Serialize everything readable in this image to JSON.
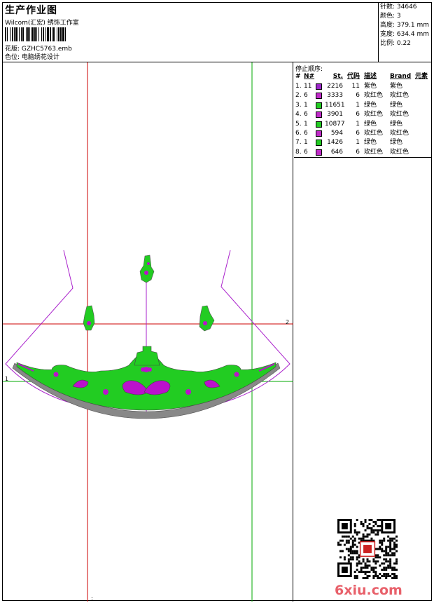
{
  "header": {
    "title": "生产作业图",
    "subtitle": "Wilcom(汇宏) 绣饰工作室",
    "file_label": "花版: GZHC5763.emb",
    "color_label": "色位: 电脑绣花设计"
  },
  "stats": {
    "stitches": "针数: 34646",
    "colors": "颜色: 3",
    "height": "高度: 379.1 mm",
    "width": "宽度: 634.4 mm",
    "scale": "比例: 0.22"
  },
  "stop_sequence": {
    "title": "停止顺序:",
    "headers": {
      "index": "#",
      "needle": "N#",
      "stitches": "St.",
      "code": "代码",
      "description": "描述",
      "brand": "Brand",
      "element": "元素"
    },
    "rows": [
      {
        "no": "1.",
        "needle": "11",
        "color": "#9c27c9",
        "stitches": "2216",
        "code": "11",
        "description": "紫色",
        "brand": "紫色"
      },
      {
        "no": "2.",
        "needle": "6",
        "color": "#c02ac8",
        "stitches": "3333",
        "code": "6",
        "description": "玫红色",
        "brand": "玫红色"
      },
      {
        "no": "3.",
        "needle": "1",
        "color": "#22cc22",
        "stitches": "11651",
        "code": "1",
        "description": "绿色",
        "brand": "绿色"
      },
      {
        "no": "4.",
        "needle": "6",
        "color": "#c02ac8",
        "stitches": "3901",
        "code": "6",
        "description": "玫红色",
        "brand": "玫红色"
      },
      {
        "no": "5.",
        "needle": "1",
        "color": "#22cc22",
        "stitches": "10877",
        "code": "1",
        "description": "绿色",
        "brand": "绿色"
      },
      {
        "no": "6.",
        "needle": "6",
        "color": "#c02ac8",
        "stitches": "594",
        "code": "6",
        "description": "玫红色",
        "brand": "玫红色"
      },
      {
        "no": "7.",
        "needle": "1",
        "color": "#22cc22",
        "stitches": "1426",
        "code": "1",
        "description": "绿色",
        "brand": "绿色"
      },
      {
        "no": "8.",
        "needle": "6",
        "color": "#c02ac8",
        "stitches": "646",
        "code": "6",
        "description": "玫红色",
        "brand": "玫红色"
      }
    ]
  },
  "canvas": {
    "tick_one": "1",
    "tick_two": "2",
    "tick_colon": ":",
    "colors": {
      "guide_red": "#cc0000",
      "guide_green": "#00aa00",
      "outline": "#aa22cc",
      "fill_green": "#22cc22",
      "accent_purple": "#bb11cc",
      "shadow": "#555555"
    }
  },
  "watermark": {
    "text": "6xiu.com",
    "qr_seal": "qr-code-with-seal"
  }
}
